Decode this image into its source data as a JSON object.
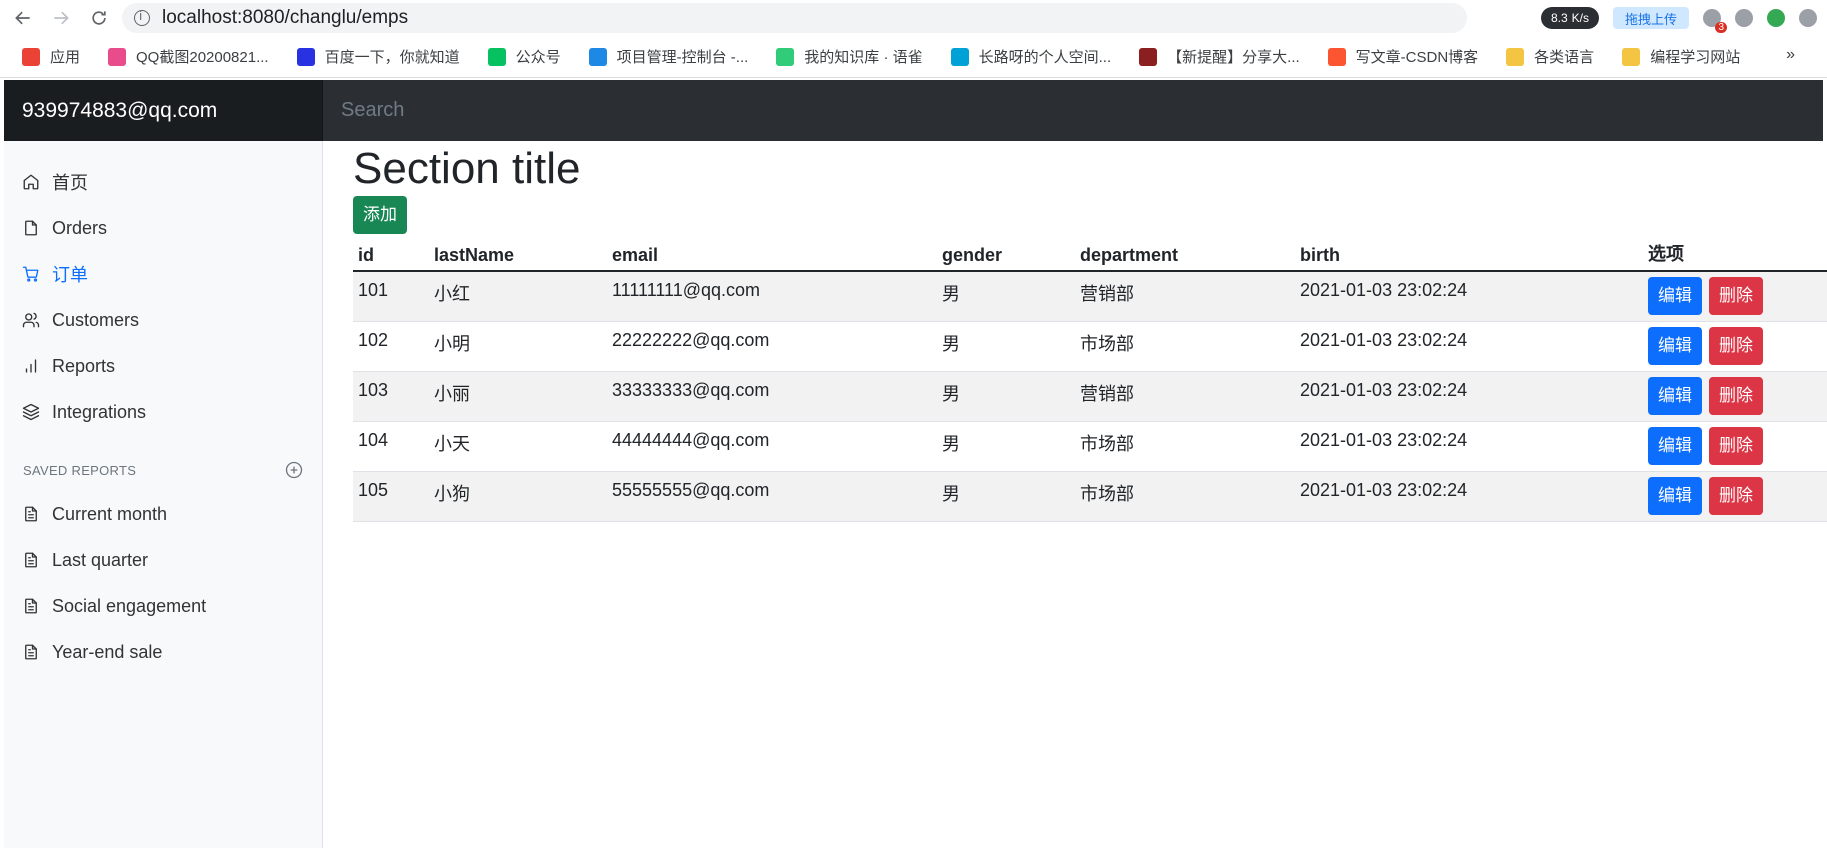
{
  "browser": {
    "url": "localhost:8080/changlu/emps",
    "speed": "8.3",
    "speed_unit": "K/s",
    "upload_label": "拖拽上传",
    "badge_count": "3"
  },
  "bookmarks": [
    {
      "label": "应用",
      "color": "#ea4335"
    },
    {
      "label": "QQ截图20200821...",
      "color": "#e84c8b"
    },
    {
      "label": "百度一下，你就知道",
      "color": "#2932e1"
    },
    {
      "label": "公众号",
      "color": "#07c160"
    },
    {
      "label": "项目管理-控制台 -...",
      "color": "#1e88e5"
    },
    {
      "label": "我的知识库 · 语雀",
      "color": "#31cc79"
    },
    {
      "label": "长路呀的个人空间...",
      "color": "#00a1d6"
    },
    {
      "label": "【新提醒】分享大...",
      "color": "#8b1e1e"
    },
    {
      "label": "写文章-CSDN博客",
      "color": "#fc5531"
    },
    {
      "label": "各类语言",
      "color": "#f4c542"
    },
    {
      "label": "编程学习网站",
      "color": "#f4c542"
    }
  ],
  "bookmarks_more": "»",
  "header": {
    "brand": "939974883@qq.com",
    "search_placeholder": "Search"
  },
  "sidebar": {
    "items": [
      {
        "label": "首页",
        "icon": "home-icon"
      },
      {
        "label": "Orders",
        "icon": "file-icon"
      },
      {
        "label": "订单",
        "icon": "cart-icon",
        "active": true
      },
      {
        "label": "Customers",
        "icon": "users-icon"
      },
      {
        "label": "Reports",
        "icon": "bar-chart-icon"
      },
      {
        "label": "Integrations",
        "icon": "layers-icon"
      }
    ],
    "saved_heading": "SAVED REPORTS",
    "saved": [
      {
        "label": "Current month",
        "icon": "file-text-icon"
      },
      {
        "label": "Last quarter",
        "icon": "file-text-icon"
      },
      {
        "label": "Social engagement",
        "icon": "file-text-icon"
      },
      {
        "label": "Year-end sale",
        "icon": "file-text-icon"
      }
    ]
  },
  "main": {
    "title": "Section title",
    "add_label": "添加",
    "columns": [
      "id",
      "lastName",
      "email",
      "gender",
      "department",
      "birth",
      "选项"
    ],
    "rows": [
      {
        "id": "101",
        "lastName": "小红",
        "email": "11111111@qq.com",
        "gender": "男",
        "department": "营销部",
        "birth": "2021-01-03 23:02:24"
      },
      {
        "id": "102",
        "lastName": "小明",
        "email": "22222222@qq.com",
        "gender": "男",
        "department": "市场部",
        "birth": "2021-01-03 23:02:24"
      },
      {
        "id": "103",
        "lastName": "小丽",
        "email": "33333333@qq.com",
        "gender": "男",
        "department": "营销部",
        "birth": "2021-01-03 23:02:24"
      },
      {
        "id": "104",
        "lastName": "小天",
        "email": "44444444@qq.com",
        "gender": "男",
        "department": "市场部",
        "birth": "2021-01-03 23:02:24"
      },
      {
        "id": "105",
        "lastName": "小狗",
        "email": "55555555@qq.com",
        "gender": "男",
        "department": "市场部",
        "birth": "2021-01-03 23:02:24"
      }
    ],
    "edit_label": "编辑",
    "delete_label": "删除"
  }
}
